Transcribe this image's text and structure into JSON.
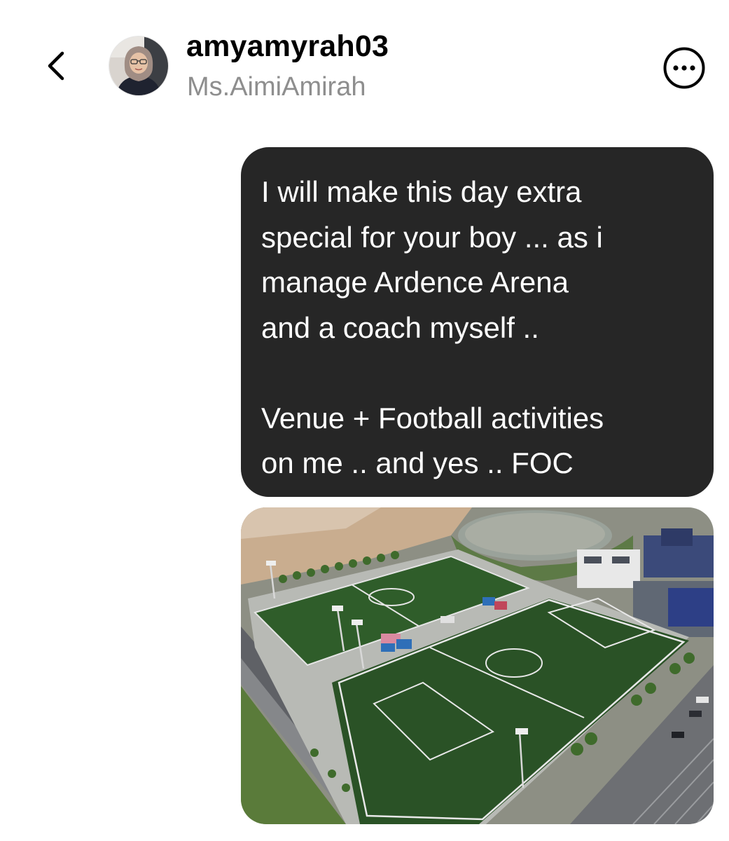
{
  "header": {
    "back_icon": "chevron-left-icon",
    "username": "amyamyrah03",
    "display_name": "Ms.AimiAmirah",
    "more_icon": "more-horizontal-circle-icon"
  },
  "messages": [
    {
      "type": "text",
      "sender": "me",
      "lines": [
        "I will make this day extra",
        "special for your boy ... as i",
        "manage Ardence Arena",
        "and a coach myself ..",
        "",
        "Venue + Football activities",
        "on me .. and yes .. FOC"
      ]
    },
    {
      "type": "image",
      "sender": "me"
    }
  ],
  "colors": {
    "bubble_background": "#262626",
    "bubble_text": "#ffffff",
    "secondary_text": "#8e8e8e",
    "page_background": "#ffffff"
  }
}
